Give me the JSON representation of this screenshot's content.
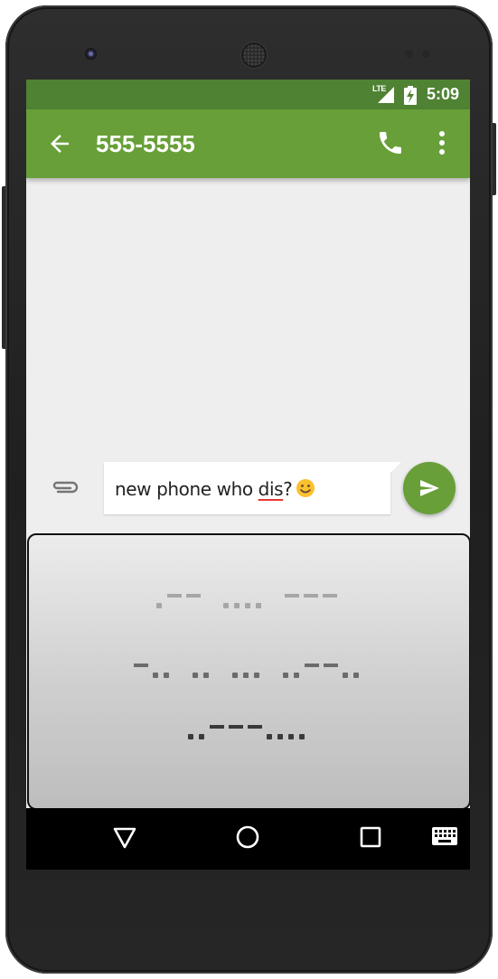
{
  "status_bar": {
    "time": "5:09",
    "network_label": "LTE",
    "icons": [
      "signal-icon",
      "battery-charging-icon"
    ]
  },
  "app_bar": {
    "title": "555-5555",
    "icons": [
      "back-arrow-icon",
      "phone-call-icon",
      "more-vert-icon"
    ]
  },
  "compose": {
    "text_before": "new phone who ",
    "text_misspelled": "dis",
    "text_after": "?",
    "emoji": "slightly-smiling-face",
    "icons": [
      "paperclip-icon",
      "send-icon"
    ]
  },
  "keyboard": {
    "type": "morse-code",
    "rows": [
      {
        "symbols": ".--  ....  ---",
        "color": "#a6a6a6"
      },
      {
        "symbols": "-..  ..  ...  ..--..",
        "color": "#6b6b6b"
      },
      {
        "symbols": "..---....",
        "color": "#3a3a3a"
      }
    ]
  },
  "nav_bar": {
    "icons": [
      "back-triangle-icon",
      "home-circle-icon",
      "recents-square-icon",
      "keyboard-switch-icon"
    ]
  },
  "colors": {
    "status_bar": "#4f8233",
    "app_bar": "#689f38",
    "background": "#eeeeee"
  }
}
